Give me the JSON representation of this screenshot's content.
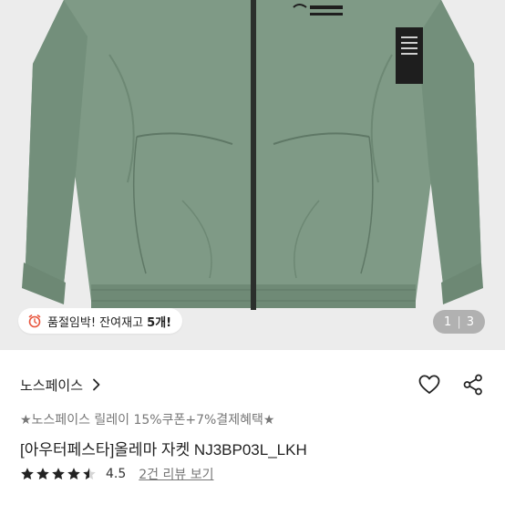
{
  "gallery": {
    "stock_notice_prefix": "품절임박! 잔여재고 ",
    "stock_notice_count": "5개!",
    "page_current": "1",
    "page_total": "3"
  },
  "product": {
    "brand": "노스페이스",
    "promo": "★노스페이스 릴레이 15%쿠폰+7%결제혜택★",
    "title": "[아우터페스타]올레마 자켓 NJ3BP03L_LKH",
    "rating": "4.5",
    "rating_value": 4.5,
    "rating_max": 5,
    "review_link": "2건 리뷰 보기"
  },
  "colors": {
    "jacket": "#7f9a86",
    "star": "#222222",
    "muted_text": "#777777"
  },
  "icons": [
    "alarm-clock-icon",
    "chevron-right-icon",
    "heart-icon",
    "share-icon",
    "star-icon"
  ]
}
